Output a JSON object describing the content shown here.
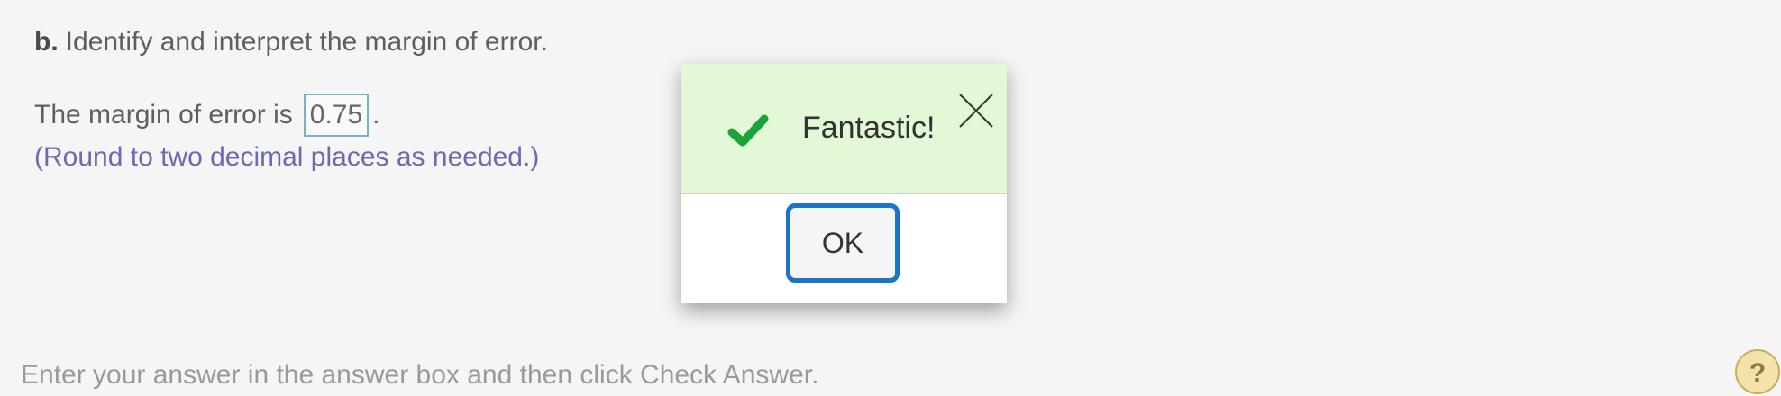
{
  "question": {
    "part_label": "b.",
    "prompt": "Identify and interpret the margin of error."
  },
  "answer": {
    "prefix": "The margin of error is",
    "value": "0.75",
    "suffix": ".",
    "hint": "(Round to two decimal places as needed.)"
  },
  "footer": {
    "instruction": "Enter your answer in the answer box and then click Check Answer.",
    "help_label": "?"
  },
  "dialog": {
    "title": "Fantastic!",
    "ok_label": "OK",
    "header_color": "#e2f8d6",
    "check_color": "#1ca23a",
    "ok_border_color": "#1a75c7"
  }
}
